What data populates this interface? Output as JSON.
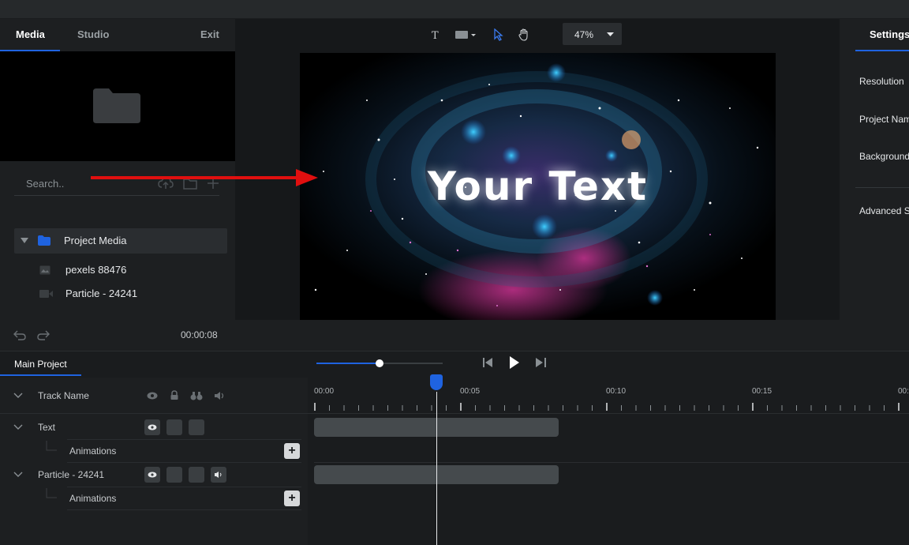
{
  "left_panel": {
    "tabs": {
      "media": "Media",
      "studio": "Studio",
      "exit": "Exit"
    },
    "search": {
      "placeholder": "Search.."
    },
    "tree": {
      "folder_label": "Project Media",
      "items": [
        {
          "label": "pexels 88476",
          "icon": "image-icon"
        },
        {
          "label": "Particle - 24241",
          "icon": "video-icon"
        }
      ]
    }
  },
  "toolbar": {
    "zoom": "47%",
    "icons": [
      "text-tool-icon",
      "shape-tool-icon",
      "pointer-tool-icon",
      "hand-tool-icon"
    ]
  },
  "canvas": {
    "overlay_text": "Your Text"
  },
  "right_panel": {
    "tab": "Settings",
    "labels": {
      "resolution": "Resolution",
      "project_name": "Project Nam",
      "background": "Background",
      "advanced": "Advanced S"
    }
  },
  "history": {
    "time": "00:00:08"
  },
  "timeline": {
    "tab": "Main Project",
    "header": {
      "track_name": "Track Name"
    },
    "tracks": [
      {
        "name": "Text",
        "sub": "Animations"
      },
      {
        "name": "Particle - 24241",
        "sub": "Animations"
      }
    ],
    "ruler": [
      "00:00",
      "00:05",
      "00:10",
      "00:15",
      "00:"
    ]
  },
  "colors": {
    "accent": "#1f63e0",
    "arrow": "#e00f0f"
  }
}
